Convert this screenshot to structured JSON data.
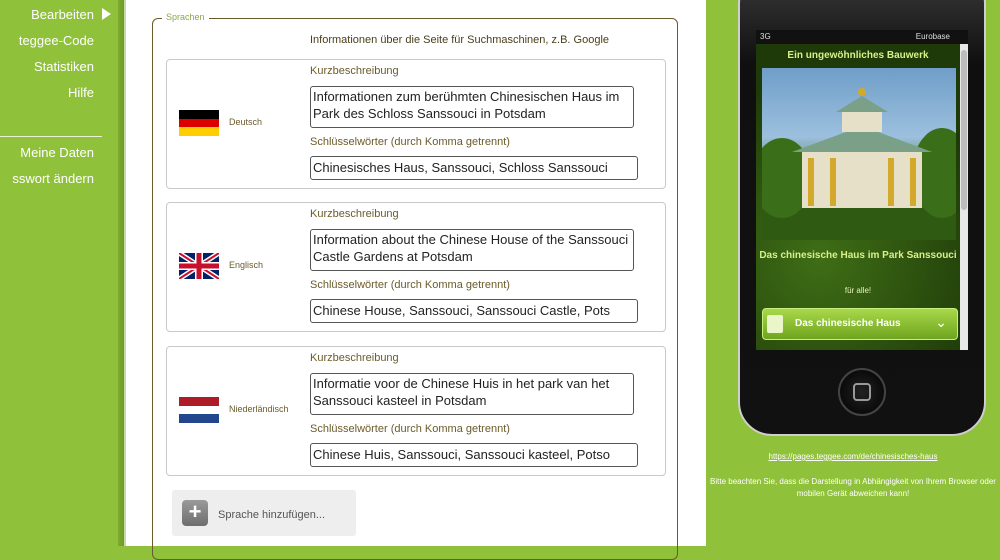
{
  "sidebar": {
    "items": [
      {
        "label": "Bearbeiten"
      },
      {
        "label": "teggee-Code"
      },
      {
        "label": "Statistiken"
      },
      {
        "label": "Hilfe"
      }
    ],
    "account_items": [
      {
        "label": "Meine Daten"
      },
      {
        "label": "sswort ändern"
      }
    ]
  },
  "main": {
    "legend": "Sprachen",
    "info": "Informationen über die Seite für Suchmaschinen, z.B. Google",
    "languages": [
      {
        "name": "Deutsch",
        "short_label": "Kurzbeschreibung",
        "short_value": "Informationen zum berühmten Chinesischen Haus im Park des Schloss Sanssouci in Potsdam",
        "keywords_label": "Schlüsselwörter (durch Komma getrennt)",
        "keywords_value": "Chinesisches Haus, Sanssouci, Schloss Sanssouci"
      },
      {
        "name": "Englisch",
        "short_label": "Kurzbeschreibung",
        "short_value": "Information about the Chinese House of the Sanssouci Castle Gardens at Potsdam",
        "keywords_label": "Schlüsselwörter (durch Komma getrennt)",
        "keywords_value": "Chinese House, Sanssouci, Sanssouci Castle, Pots"
      },
      {
        "name": "Niederländisch",
        "short_label": "Kurzbeschreibung",
        "short_value": "Informatie voor de Chinese Huis in het park van het Sanssouci kasteel in Potsdam",
        "keywords_label": "Schlüsselwörter (durch Komma getrennt)",
        "keywords_value": "Chinese Huis, Sanssouci, Sanssouci kasteel, Potso"
      }
    ],
    "add_language": "Sprache hinzufügen..."
  },
  "preview": {
    "status_signal": "3G",
    "status_carrier": "Eurobase",
    "title": "Ein ungewöhnliches Bauwerk",
    "caption": "Das chinesische Haus im Park Sanssouci",
    "subcaption": "für alle!",
    "button_label": "Das chinesische Haus",
    "url": "https://pages.teggee.com/de/chinesisches-haus",
    "note": "Bitte beachten Sie, dass die Darstellung in Abhängigkeit von Ihrem Browser oder mobilen Gerät abweichen kann!"
  },
  "colors": {
    "brand_green": "#8fc13a",
    "fieldset_border": "#6b5b2a"
  }
}
